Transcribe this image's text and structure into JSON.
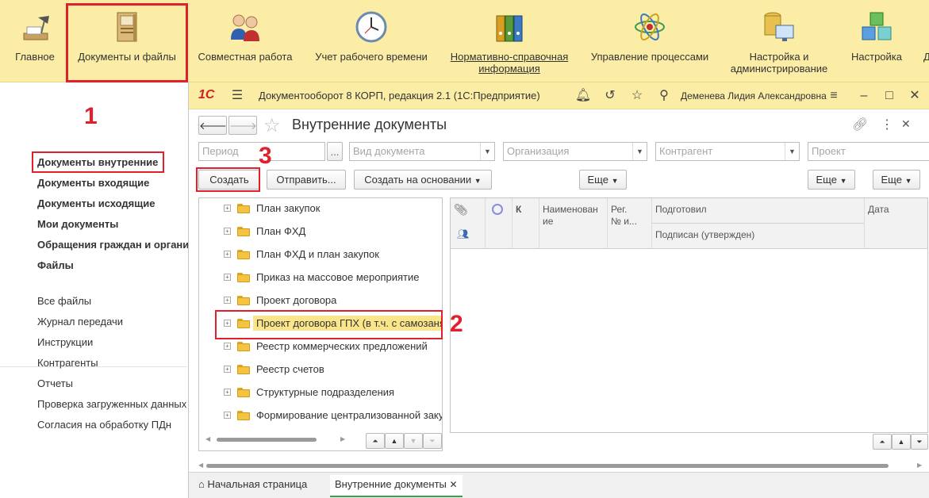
{
  "sections": [
    {
      "label": "Главное",
      "icon": "desk-lamp-icon"
    },
    {
      "label": "Документы и файлы",
      "icon": "document-folder-icon"
    },
    {
      "label": "Совместная работа",
      "icon": "people-icon"
    },
    {
      "label": "Учет рабочего времени",
      "icon": "clock-icon"
    },
    {
      "label": "Нормативно-справочная информация",
      "line1": "Нормативно-справочная",
      "line2": "информация",
      "icon": "binders-icon"
    },
    {
      "label": "Управление процессами",
      "icon": "process-atom-icon"
    },
    {
      "label": "Настройка и администрирование",
      "line1": "Настройка и",
      "line2": "администрирование",
      "icon": "database-monitor-icon"
    },
    {
      "label": "Настройка",
      "icon": "cubes-icon"
    }
  ],
  "annotations": {
    "n1": "1",
    "n2": "2",
    "n3": "3",
    "color": "#e0202a"
  },
  "left_nav": {
    "main_items": [
      "Документы внутренние",
      "Документы входящие",
      "Документы исходящие",
      "Мои документы",
      "Обращения граждан и организаций",
      "Файлы"
    ],
    "other_items": [
      "Все файлы",
      "Журнал передачи",
      "Инструкции",
      "Контрагенты",
      "Отчеты",
      "Проверка загруженных данных",
      "Согласия на обработку ПДн"
    ]
  },
  "window": {
    "logo": "1С",
    "title": "Документооборот 8 КОРП, редакция 2.1  (1С:Предприятие)",
    "user": "Деменева Лидия Александровна"
  },
  "form": {
    "title": "Внутренние документы",
    "filters": {
      "period": "Период",
      "period_btn": "...",
      "doc_kind": "Вид документа",
      "org": "Организация",
      "counterparty": "Контрагент",
      "project": "Проект"
    },
    "buttons": {
      "create": "Создать",
      "send": "Отправить...",
      "create_based": "Создать на основании",
      "more1": "Еще",
      "more2": "Еще",
      "more3": "Еще"
    }
  },
  "tree_items": [
    "План закупок",
    "План ФХД",
    "План ФХД и план закупок",
    "Приказ на массовое мероприятие",
    "Проект договора",
    "Проект договора ГПХ (в т.ч. с самозанятыми)",
    "Реестр коммерческих предложений",
    "Реестр счетов",
    "Структурные подразделения",
    "Формирование централизованной закупки"
  ],
  "tree_selected_index": 5,
  "grid": {
    "col_k": "К",
    "col_name_l1": "Наименован",
    "col_name_l2": "ие",
    "col_reg_l1": "Рег.",
    "col_reg_l2": "№ и...",
    "col_prepared": "Подготовил",
    "col_signed": "Подписан (утвержден)",
    "col_date": "Дата"
  },
  "tabs": {
    "home": "Начальная страница",
    "current": "Внутренние документы"
  }
}
